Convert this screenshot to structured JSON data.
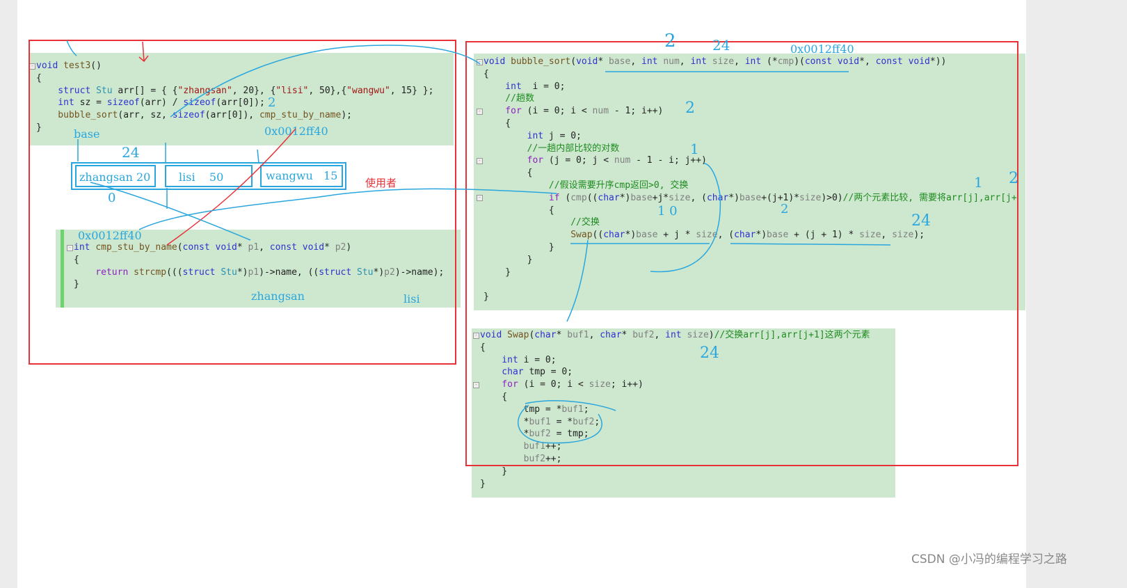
{
  "colors": {
    "highlight": "#cde8cf",
    "frame": "#e8323a",
    "annotation": "#2aa6de"
  },
  "blocks": {
    "test3": [
      [
        [
          "void ",
          "kw"
        ],
        [
          "test3",
          "fn"
        ],
        [
          "()",
          "pl"
        ]
      ],
      [
        [
          "{",
          "pl"
        ]
      ],
      [
        [
          "    struct ",
          "kw"
        ],
        [
          "Stu ",
          "ty"
        ],
        [
          "arr[] = { {",
          "pl"
        ],
        [
          "\"zhangsan\"",
          "str"
        ],
        [
          ", 20}, {",
          "pl"
        ],
        [
          "\"lisi\"",
          "str"
        ],
        [
          ", 50},{",
          "pl"
        ],
        [
          "\"wangwu\"",
          "str"
        ],
        [
          ", 15} };",
          "pl"
        ]
      ],
      [
        [
          "    int ",
          "kw"
        ],
        [
          "sz = ",
          "pl"
        ],
        [
          "sizeof",
          "kw"
        ],
        [
          "(arr) / ",
          "pl"
        ],
        [
          "sizeof",
          "kw"
        ],
        [
          "(arr[0]);",
          "pl"
        ]
      ],
      [
        [
          "    bubble_sort",
          "fn"
        ],
        [
          "(arr, sz, ",
          "pl"
        ],
        [
          "sizeof",
          "kw"
        ],
        [
          "(arr[0]), ",
          "pl"
        ],
        [
          "cmp_stu_by_name",
          "fn"
        ],
        [
          ");",
          "pl"
        ]
      ],
      [
        [
          "}",
          "pl"
        ]
      ]
    ],
    "cmp": [
      [
        [
          "int ",
          "kw"
        ],
        [
          "cmp_stu_by_name",
          "fn"
        ],
        [
          "(",
          "pl"
        ],
        [
          "const void",
          "kw"
        ],
        [
          "* ",
          "pl"
        ],
        [
          "p1",
          "pm"
        ],
        [
          ", ",
          "pl"
        ],
        [
          "const void",
          "kw"
        ],
        [
          "* ",
          "pl"
        ],
        [
          "p2",
          "pm"
        ],
        [
          ")",
          "pl"
        ]
      ],
      [
        [
          "{",
          "pl"
        ]
      ],
      [
        [
          "    return ",
          "ctl"
        ],
        [
          "strcmp",
          "fn"
        ],
        [
          "(((",
          "pl"
        ],
        [
          "struct ",
          "kw"
        ],
        [
          "Stu",
          "ty"
        ],
        [
          "*)",
          "pl"
        ],
        [
          "p1",
          "pm"
        ],
        [
          ")->name, ((",
          "pl"
        ],
        [
          "struct ",
          "kw"
        ],
        [
          "Stu",
          "ty"
        ],
        [
          "*)",
          "pl"
        ],
        [
          "p2",
          "pm"
        ],
        [
          ")->name);",
          "pl"
        ]
      ],
      [
        [
          "}",
          "pl"
        ]
      ]
    ],
    "bubble": [
      [
        [
          "void ",
          "kw"
        ],
        [
          "bubble_sort",
          "fn"
        ],
        [
          "(",
          "pl"
        ],
        [
          "void",
          "kw"
        ],
        [
          "* ",
          "pl"
        ],
        [
          "base",
          "pm"
        ],
        [
          ", ",
          "pl"
        ],
        [
          "int ",
          "kw"
        ],
        [
          "num",
          "pm"
        ],
        [
          ", ",
          "pl"
        ],
        [
          "int ",
          "kw"
        ],
        [
          "size",
          "pm"
        ],
        [
          ", ",
          "pl"
        ],
        [
          "int ",
          "kw"
        ],
        [
          "(*",
          "pl"
        ],
        [
          "cmp",
          "pm"
        ],
        [
          ")(",
          "pl"
        ],
        [
          "const void",
          "kw"
        ],
        [
          "*, ",
          "pl"
        ],
        [
          "const void",
          "kw"
        ],
        [
          "*))",
          "pl"
        ]
      ],
      [
        [
          "{",
          "pl"
        ]
      ],
      [
        [
          "    int ",
          "kw"
        ],
        [
          " i = 0;",
          "pl"
        ]
      ],
      [
        [
          "    //趟数",
          "cm"
        ]
      ],
      [
        [
          "    for ",
          "ctl"
        ],
        [
          "(i = 0; i < ",
          "pl"
        ],
        [
          "num",
          "pm"
        ],
        [
          " - 1; i++)",
          "pl"
        ]
      ],
      [
        [
          "    {",
          "pl"
        ]
      ],
      [
        [
          "        int ",
          "kw"
        ],
        [
          "j = 0;",
          "pl"
        ]
      ],
      [
        [
          "        //一趟内部比较的对数",
          "cm"
        ]
      ],
      [
        [
          "        for ",
          "ctl"
        ],
        [
          "(j = 0; j < ",
          "pl"
        ],
        [
          "num",
          "pm"
        ],
        [
          " - 1 - i; j++)",
          "pl"
        ]
      ],
      [
        [
          "        {",
          "pl"
        ]
      ],
      [
        [
          "            //假设需要升序cmp返回>0, 交换",
          "cm"
        ]
      ],
      [
        [
          "            if ",
          "ctl"
        ],
        [
          "(",
          "pl"
        ],
        [
          "cmp",
          "pm"
        ],
        [
          "((",
          "pl"
        ],
        [
          "char",
          "kw"
        ],
        [
          "*)",
          "pl"
        ],
        [
          "base",
          "pm"
        ],
        [
          "+j*",
          "pl"
        ],
        [
          "size",
          "pm"
        ],
        [
          ", (",
          "pl"
        ],
        [
          "char",
          "kw"
        ],
        [
          "*)",
          "pl"
        ],
        [
          "base",
          "pm"
        ],
        [
          "+(j+1)*",
          "pl"
        ],
        [
          "size",
          "pm"
        ],
        [
          ")>0)",
          "pl"
        ],
        [
          "//两个元素比较, 需要将arr[j],arr[j+",
          "cm"
        ]
      ],
      [
        [
          "            {",
          "pl"
        ]
      ],
      [
        [
          "                //交换",
          "cm"
        ]
      ],
      [
        [
          "                Swap",
          "fn"
        ],
        [
          "((",
          "pl"
        ],
        [
          "char",
          "kw"
        ],
        [
          "*)",
          "pl"
        ],
        [
          "base",
          "pm"
        ],
        [
          " + j * ",
          "pl"
        ],
        [
          "size",
          "pm"
        ],
        [
          ", (",
          "pl"
        ],
        [
          "char",
          "kw"
        ],
        [
          "*)",
          "pl"
        ],
        [
          "base",
          "pm"
        ],
        [
          " + (j + 1) * ",
          "pl"
        ],
        [
          "size",
          "pm"
        ],
        [
          ", ",
          "pl"
        ],
        [
          "size",
          "pm"
        ],
        [
          ");",
          "pl"
        ]
      ],
      [
        [
          "            }",
          "pl"
        ]
      ],
      [
        [
          "        }",
          "pl"
        ]
      ],
      [
        [
          "    }",
          "pl"
        ]
      ],
      [
        [
          "",
          "pl"
        ]
      ],
      [
        [
          "}",
          "pl"
        ]
      ]
    ],
    "swap": [
      [
        [
          "void ",
          "kw"
        ],
        [
          "Swap",
          "fn"
        ],
        [
          "(",
          "pl"
        ],
        [
          "char",
          "kw"
        ],
        [
          "* ",
          "pl"
        ],
        [
          "buf1",
          "pm"
        ],
        [
          ", ",
          "pl"
        ],
        [
          "char",
          "kw"
        ],
        [
          "* ",
          "pl"
        ],
        [
          "buf2",
          "pm"
        ],
        [
          ", ",
          "pl"
        ],
        [
          "int ",
          "kw"
        ],
        [
          "size",
          "pm"
        ],
        [
          ")",
          "pl"
        ],
        [
          "//交换arr[j],arr[j+1]这两个元素",
          "cm"
        ]
      ],
      [
        [
          "{",
          "pl"
        ]
      ],
      [
        [
          "    int ",
          "kw"
        ],
        [
          "i = 0;",
          "pl"
        ]
      ],
      [
        [
          "    char ",
          "kw"
        ],
        [
          "tmp = 0;",
          "pl"
        ]
      ],
      [
        [
          "    for ",
          "ctl"
        ],
        [
          "(i = 0; i < ",
          "pl"
        ],
        [
          "size",
          "pm"
        ],
        [
          "; i++)",
          "pl"
        ]
      ],
      [
        [
          "    {",
          "pl"
        ]
      ],
      [
        [
          "        tmp = *",
          "pl"
        ],
        [
          "buf1",
          "pm"
        ],
        [
          ";",
          "pl"
        ]
      ],
      [
        [
          "        *",
          "pl"
        ],
        [
          "buf1",
          "pm"
        ],
        [
          " = *",
          "pl"
        ],
        [
          "buf2",
          "pm"
        ],
        [
          ";",
          "pl"
        ]
      ],
      [
        [
          "        *",
          "pl"
        ],
        [
          "buf2",
          "pm"
        ],
        [
          " = tmp;",
          "pl"
        ]
      ],
      [
        [
          "        ",
          "pl"
        ],
        [
          "buf1",
          "pm"
        ],
        [
          "++;",
          "pl"
        ]
      ],
      [
        [
          "        ",
          "pl"
        ],
        [
          "buf2",
          "pm"
        ],
        [
          "++;",
          "pl"
        ]
      ],
      [
        [
          "    }",
          "pl"
        ]
      ],
      [
        [
          "}",
          "pl"
        ]
      ]
    ]
  },
  "memory": {
    "cells": [
      {
        "name": "zhangsan",
        "age": "20"
      },
      {
        "name": "lisi",
        "age": "50"
      },
      {
        "name": "wangwu",
        "age": "15"
      }
    ]
  },
  "annotations": {
    "base": "base",
    "addr1": "0x0012ff40",
    "addr2": "0x0012ff40",
    "addr3": "0x0012ff40",
    "user": "使用者",
    "zhangsan": "zhangsan",
    "lisi": "lisi",
    "n2a": "2",
    "n24a": "24",
    "n24b": "24",
    "n2b": "2",
    "n24c": "24",
    "n2c": "2",
    "n0": "0",
    "n1": "1",
    "n10": "1 0"
  },
  "watermark": "CSDN @小冯的编程学习之路"
}
